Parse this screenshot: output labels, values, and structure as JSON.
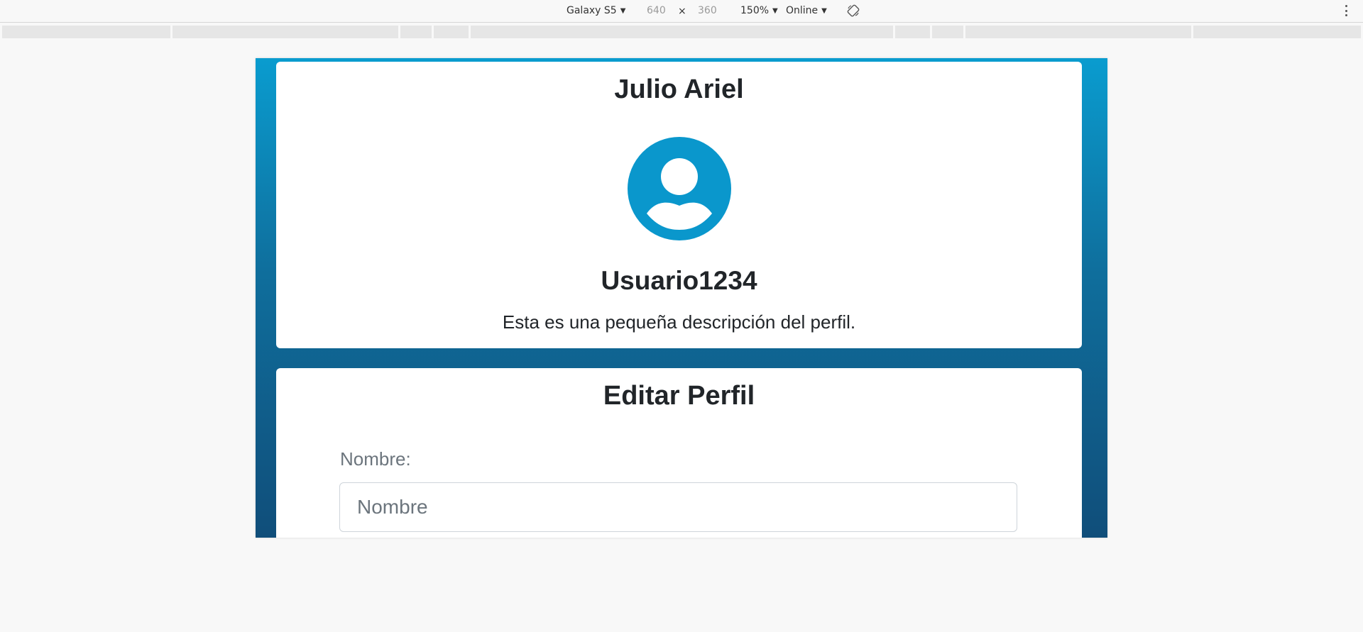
{
  "devtools": {
    "device": "Galaxy S5",
    "width": "640",
    "times": "×",
    "height": "360",
    "zoom": "150%",
    "network": "Online",
    "dropdown_arrow": "▼",
    "icons": [
      "rotate-icon",
      "more-options-icon"
    ]
  },
  "profile": {
    "name": "Julio Ariel",
    "username": "Usuario1234",
    "description": "Esta es una pequeña descripción del perfil.",
    "avatar_icon": "user-avatar-icon",
    "avatar_color": "#0a97cc"
  },
  "edit": {
    "title": "Editar Perfil",
    "name_label": "Nombre:",
    "name_placeholder": "Nombre",
    "name_value": ""
  },
  "colors": {
    "gradient_top": "#0a9ccf",
    "gradient_bottom": "#104e7a",
    "card": "#ffffff"
  }
}
